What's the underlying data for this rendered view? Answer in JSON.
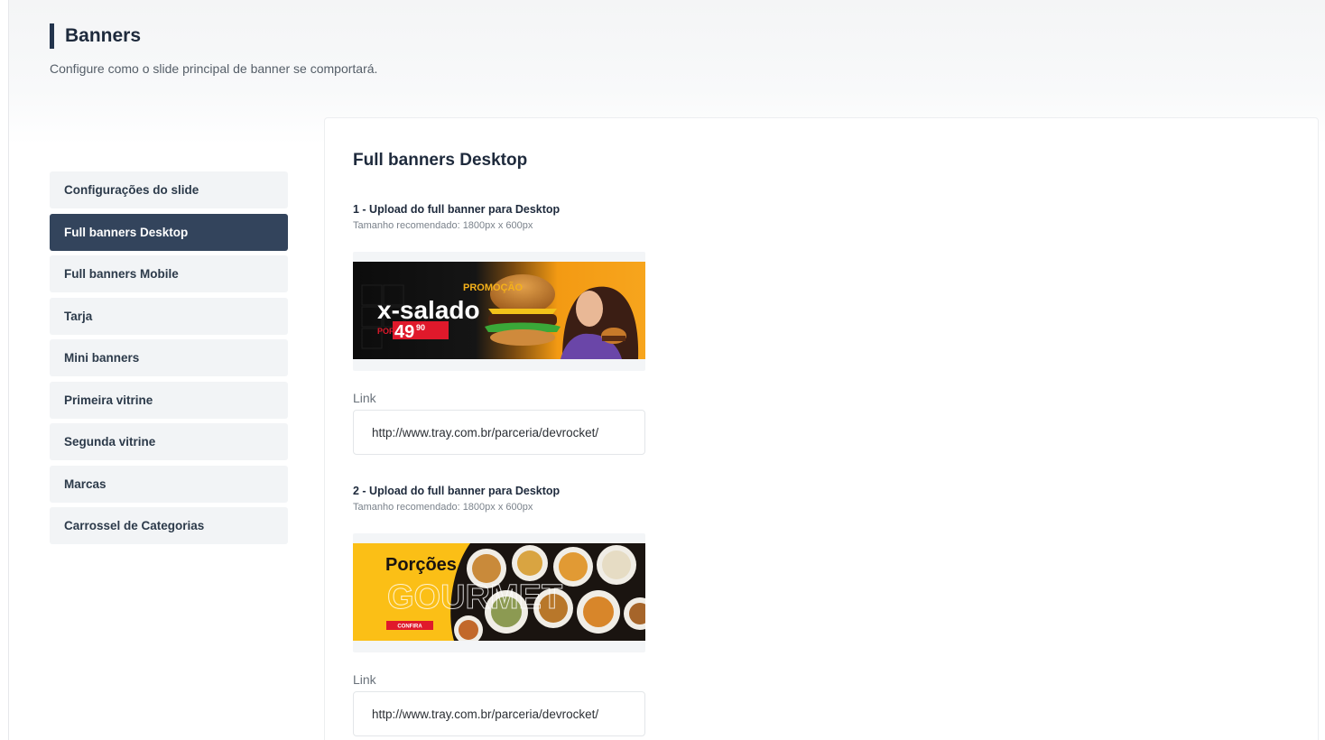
{
  "header": {
    "title": "Banners",
    "subtitle": "Configure como o slide principal de banner se comportará."
  },
  "sidebar": {
    "items": [
      {
        "label": "Configurações do slide",
        "active": false
      },
      {
        "label": "Full banners Desktop",
        "active": true
      },
      {
        "label": "Full banners Mobile",
        "active": false
      },
      {
        "label": "Tarja",
        "active": false
      },
      {
        "label": "Mini banners",
        "active": false
      },
      {
        "label": "Primeira vitrine",
        "active": false
      },
      {
        "label": "Segunda vitrine",
        "active": false
      },
      {
        "label": "Marcas",
        "active": false
      },
      {
        "label": "Carrossel de Categorias",
        "active": false
      }
    ]
  },
  "main": {
    "title": "Full banners Desktop",
    "banners": [
      {
        "upload_label": "1 - Upload do full banner para Desktop",
        "hint": "Tamanho recomendado: 1800px x 600px",
        "image_text": {
          "promo": "PROMOÇÃO",
          "product": "x-salado",
          "por": "POR",
          "price": "49",
          "cents": "90"
        },
        "link_label": "Link",
        "link_value": "http://www.tray.com.br/parceria/devrocket/"
      },
      {
        "upload_label": "2 - Upload do full banner para Desktop",
        "hint": "Tamanho recomendado: 1800px x 600px",
        "image_text": {
          "title": "Porções",
          "outline": "GOURMET",
          "button": "CONFIRA"
        },
        "link_label": "Link",
        "link_value": "http://www.tray.com.br/parceria/devrocket/"
      }
    ]
  },
  "colors": {
    "primary_dark": "#33445c",
    "title_bar": "#23344d",
    "sidebar_bg": "#f2f4f6",
    "banner1_orange": "#f39a13",
    "banner1_price_red": "#e0192b",
    "banner2_yellow": "#fbbf16"
  }
}
